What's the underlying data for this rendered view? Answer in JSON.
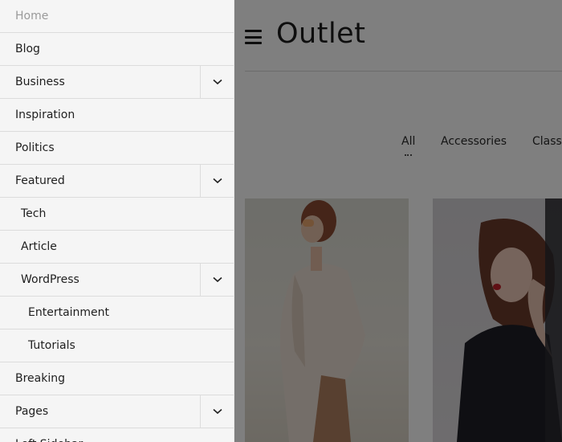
{
  "header": {
    "menu_icon": "hamburger-menu-icon",
    "site_title": "Outlet"
  },
  "filters": {
    "items": [
      "All",
      "Accessories",
      "Classi"
    ],
    "active": "All"
  },
  "menu": {
    "items": [
      {
        "label": "Home",
        "level": 0,
        "has_submenu": false
      },
      {
        "label": "Blog",
        "level": 0,
        "has_submenu": false
      },
      {
        "label": "Business",
        "level": 0,
        "has_submenu": true
      },
      {
        "label": "Inspiration",
        "level": 0,
        "has_submenu": false
      },
      {
        "label": "Politics",
        "level": 0,
        "has_submenu": false
      },
      {
        "label": "Featured",
        "level": 0,
        "has_submenu": true
      },
      {
        "label": "Tech",
        "level": 1,
        "has_submenu": false
      },
      {
        "label": "Article",
        "level": 1,
        "has_submenu": false
      },
      {
        "label": "WordPress",
        "level": 1,
        "has_submenu": true
      },
      {
        "label": "Entertainment",
        "level": 2,
        "has_submenu": false
      },
      {
        "label": "Tutorials",
        "level": 2,
        "has_submenu": false
      },
      {
        "label": "Breaking",
        "level": 0,
        "has_submenu": false
      },
      {
        "label": "Pages",
        "level": 0,
        "has_submenu": true
      },
      {
        "label": "Left Sidebar",
        "level": 0,
        "has_submenu": false
      }
    ],
    "toggle_icon": "chevron-down-icon"
  },
  "colors": {
    "menu_bg": "#f5f5f5",
    "overlay": "rgba(0,0,0,0.5)",
    "text": "#1f1f1f"
  }
}
